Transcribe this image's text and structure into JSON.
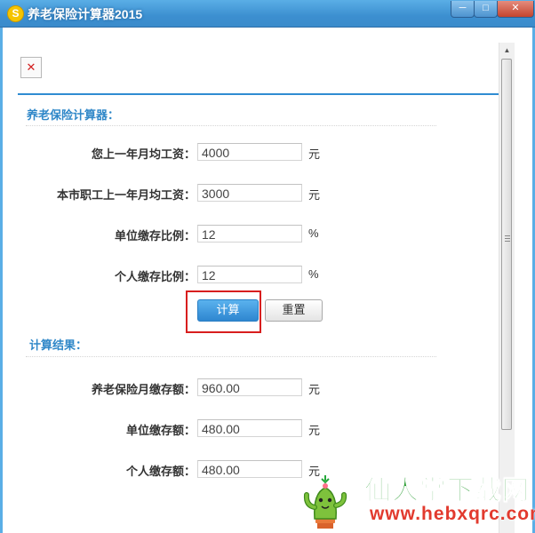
{
  "window": {
    "title": "养老保险计算器2015",
    "icon_glyph": "S",
    "buttons": [
      "─",
      "□",
      "✕"
    ]
  },
  "icons": {
    "broken_image": "✕",
    "scroll_up": "▲"
  },
  "section_input": {
    "title": "养老保险计算器：",
    "fields": [
      {
        "label": "您上一年月均工资：",
        "value": "4000",
        "unit": "元"
      },
      {
        "label": "本市职工上一年月均工资：",
        "value": "3000",
        "unit": "元"
      },
      {
        "label": "单位缴存比例：",
        "value": "12",
        "unit": "%"
      },
      {
        "label": "个人缴存比例：",
        "value": "12",
        "unit": "%"
      }
    ],
    "calc_label": "计算",
    "reset_label": "重置"
  },
  "section_result": {
    "title": "计算结果：",
    "fields": [
      {
        "label": "养老保险月缴存额：",
        "value": "960.00",
        "unit": "元"
      },
      {
        "label": "单位缴存额：",
        "value": "480.00",
        "unit": "元"
      },
      {
        "label": "个人缴存额：",
        "value": "480.00",
        "unit": "元"
      }
    ]
  },
  "watermark": {
    "name": "仙人掌下载网",
    "url": "www.hebxqrc.com"
  },
  "colors": {
    "accent": "#2f87c8",
    "highlight_box": "#d81e1e",
    "titlebar": "#3c8fd0"
  }
}
